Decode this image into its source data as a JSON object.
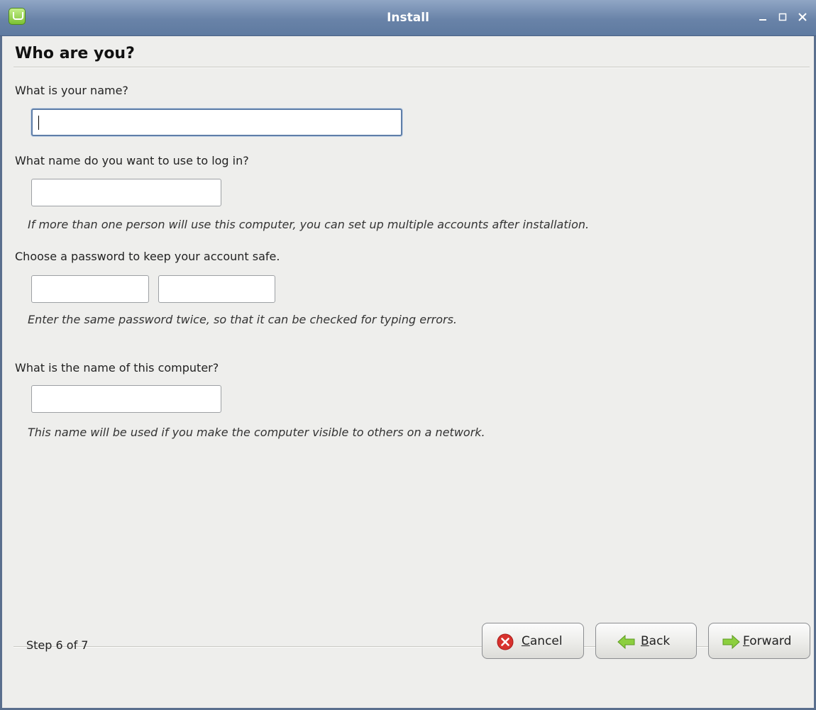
{
  "window": {
    "title": "Install"
  },
  "page": {
    "title": "Who are you?"
  },
  "fields": {
    "name": {
      "label": "What is your name?",
      "value": ""
    },
    "login": {
      "label": "What name do you want to use to log in?",
      "value": "",
      "hint": "If more than one person will use this computer, you can set up multiple accounts after installation."
    },
    "password": {
      "label": "Choose a password to keep your account safe.",
      "value": "",
      "confirm_value": "",
      "hint": "Enter the same password twice, so that it can be checked for typing errors."
    },
    "computer": {
      "label": "What is the name of this computer?",
      "value": "",
      "hint": "This name will be used if you make the computer visible to others on a network."
    }
  },
  "footer": {
    "step": "Step 6 of 7",
    "cancel": {
      "mnemonic": "C",
      "rest": "ancel"
    },
    "back": {
      "mnemonic": "B",
      "rest": "ack"
    },
    "forward": {
      "mnemonic": "F",
      "rest": "orward"
    }
  },
  "colors": {
    "titlebar": "#6983a8",
    "background": "#eeeeec",
    "cancel_icon": "#d8322e",
    "arrow_icon": "#8ccf3e"
  }
}
